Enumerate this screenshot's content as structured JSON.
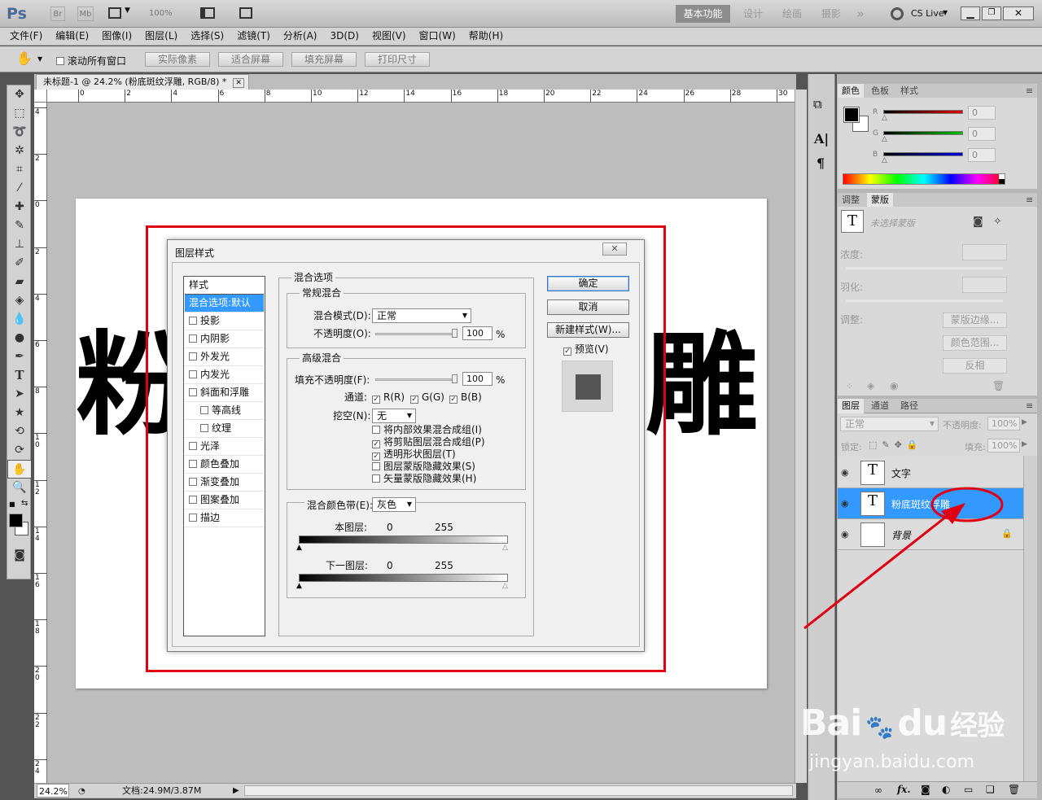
{
  "appbar": {
    "logo": "Ps",
    "br": "Br",
    "mb": "Mb",
    "zoom": "100%",
    "workspaces": [
      "基本功能",
      "设计",
      "绘画",
      "摄影"
    ],
    "more": "»",
    "cslive": "CS Live"
  },
  "menu": [
    "文件(F)",
    "编辑(E)",
    "图像(I)",
    "图层(L)",
    "选择(S)",
    "滤镜(T)",
    "分析(A)",
    "3D(D)",
    "视图(V)",
    "窗口(W)",
    "帮助(H)"
  ],
  "options": {
    "scroll_all": "滚动所有窗口",
    "buttons": [
      "实际像素",
      "适合屏幕",
      "填充屏幕",
      "打印尺寸"
    ]
  },
  "document": {
    "tab_title": "未标题-1 @ 24.2% (粉底斑纹浮雕, RGB/8) *",
    "ruler_h": [
      "0",
      "2",
      "4",
      "6",
      "8",
      "10",
      "12",
      "14",
      "16",
      "18",
      "20",
      "22",
      "24",
      "26",
      "28",
      "30"
    ],
    "ruler_v": [
      "4",
      "2",
      "0",
      "2",
      "4",
      "6",
      "8",
      "1\n0",
      "1\n2",
      "1\n4",
      "1\n6",
      "1\n8",
      "2\n0",
      "2\n2",
      "2\n4"
    ],
    "canvas_text_left": "粉",
    "canvas_text_right": "雕"
  },
  "dialog": {
    "title": "图层样式",
    "styles_header": "样式",
    "styles": [
      {
        "label": "混合选项:默认",
        "checkbox": false,
        "selected": true,
        "indent": false
      },
      {
        "label": "投影",
        "checkbox": true,
        "selected": false,
        "indent": false
      },
      {
        "label": "内阴影",
        "checkbox": true,
        "selected": false,
        "indent": false
      },
      {
        "label": "外发光",
        "checkbox": true,
        "selected": false,
        "indent": false
      },
      {
        "label": "内发光",
        "checkbox": true,
        "selected": false,
        "indent": false
      },
      {
        "label": "斜面和浮雕",
        "checkbox": true,
        "selected": false,
        "indent": false
      },
      {
        "label": "等高线",
        "checkbox": true,
        "selected": false,
        "indent": true
      },
      {
        "label": "纹理",
        "checkbox": true,
        "selected": false,
        "indent": true
      },
      {
        "label": "光泽",
        "checkbox": true,
        "selected": false,
        "indent": false
      },
      {
        "label": "颜色叠加",
        "checkbox": true,
        "selected": false,
        "indent": false
      },
      {
        "label": "渐变叠加",
        "checkbox": true,
        "selected": false,
        "indent": false
      },
      {
        "label": "图案叠加",
        "checkbox": true,
        "selected": false,
        "indent": false
      },
      {
        "label": "描边",
        "checkbox": true,
        "selected": false,
        "indent": false
      }
    ],
    "blend_options_title": "混合选项",
    "general_title": "常规混合",
    "blend_mode_label": "混合模式(D):",
    "blend_mode_value": "正常",
    "opacity_label": "不透明度(O):",
    "opacity_value": "100",
    "percent": "%",
    "advanced_title": "高级混合",
    "fill_opacity_label": "填充不透明度(F):",
    "fill_opacity_value": "100",
    "channels_label": "通道:",
    "channels": [
      "R(R)",
      "G(G)",
      "B(B)"
    ],
    "knockout_label": "挖空(N):",
    "knockout_value": "无",
    "options": [
      {
        "label": "将内部效果混合成组(I)",
        "checked": false
      },
      {
        "label": "将剪贴图层混合成组(P)",
        "checked": true
      },
      {
        "label": "透明形状图层(T)",
        "checked": true
      },
      {
        "label": "图层蒙版隐藏效果(S)",
        "checked": false
      },
      {
        "label": "矢量蒙版隐藏效果(H)",
        "checked": false
      }
    ],
    "blend_if_label": "混合颜色带(E):",
    "blend_if_value": "灰色",
    "this_layer_label": "本图层:",
    "underlying_label": "下一图层:",
    "range_low": "0",
    "range_high": "255",
    "ok": "确定",
    "cancel": "取消",
    "new_style": "新建样式(W)...",
    "preview": "预览(V)",
    "close": "✕"
  },
  "color_panel": {
    "tabs": [
      "颜色",
      "色板",
      "样式"
    ],
    "channels": [
      {
        "label": "R",
        "value": "0",
        "color": "#e00000"
      },
      {
        "label": "G",
        "value": "0",
        "color": "#00c000"
      },
      {
        "label": "B",
        "value": "0",
        "color": "#0000e0"
      }
    ]
  },
  "adjust_panel": {
    "tabs": [
      "调整",
      "蒙版"
    ],
    "no_mask": "未选择蒙版",
    "density": "浓度:",
    "feather": "羽化:",
    "adjust": "调整:",
    "buttons": [
      "蒙版边缘...",
      "颜色范围...",
      "反相"
    ]
  },
  "layers_panel": {
    "tabs": [
      "图层",
      "通道",
      "路径"
    ],
    "blend_mode": "正常",
    "opacity_label": "不透明度:",
    "opacity_value": "100%",
    "lock_label": "锁定:",
    "fill_label": "填充:",
    "fill_value": "100%",
    "layers": [
      {
        "name": "文字",
        "type": "text",
        "selected": false
      },
      {
        "name": "粉底斑纹浮雕",
        "type": "text",
        "selected": true
      },
      {
        "name": "背景",
        "type": "bg",
        "selected": false
      }
    ]
  },
  "status": {
    "zoom": "24.2%",
    "doc": "文档:24.9M/3.87M"
  },
  "watermark": {
    "brand": "Bai",
    "brand2": "du",
    "cn": "经验",
    "url": "jingyan.baidu.com"
  },
  "colors": {
    "annotation_red": "#e00012",
    "selection_blue": "#3399ff"
  }
}
